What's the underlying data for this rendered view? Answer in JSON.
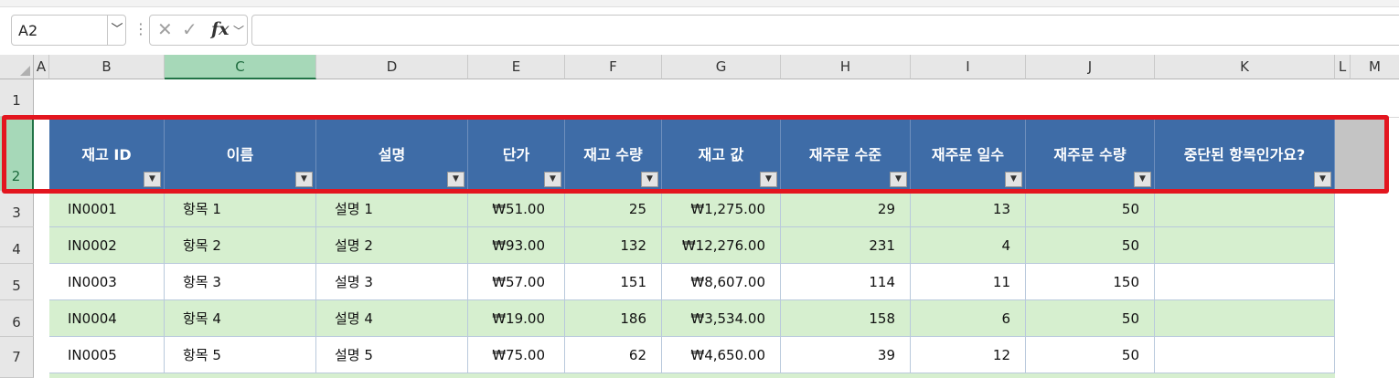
{
  "formula_bar": {
    "name_box": "A2",
    "dots": "⋮",
    "formula": ""
  },
  "columns": [
    "A",
    "B",
    "C",
    "D",
    "E",
    "F",
    "G",
    "H",
    "I",
    "J",
    "K",
    "L",
    "M"
  ],
  "rows": [
    "1",
    "2",
    "3",
    "4",
    "5",
    "6",
    "7"
  ],
  "table": {
    "headers": [
      "재고 ID",
      "이름",
      "설명",
      "단가",
      "재고 수량",
      "재고 값",
      "재주문 수준",
      "재주문 일수",
      "재주문 수량",
      "중단된 항목인가요?"
    ],
    "rows": [
      [
        "IN0001",
        "항목 1",
        "설명 1",
        "₩51.00",
        "25",
        "₩1,275.00",
        "29",
        "13",
        "50",
        ""
      ],
      [
        "IN0002",
        "항목 2",
        "설명 2",
        "₩93.00",
        "132",
        "₩12,276.00",
        "231",
        "4",
        "50",
        ""
      ],
      [
        "IN0003",
        "항목 3",
        "설명 3",
        "₩57.00",
        "151",
        "₩8,607.00",
        "114",
        "11",
        "150",
        ""
      ],
      [
        "IN0004",
        "항목 4",
        "설명 4",
        "₩19.00",
        "186",
        "₩3,534.00",
        "158",
        "6",
        "50",
        ""
      ],
      [
        "IN0005",
        "항목 5",
        "설명 5",
        "₩75.00",
        "62",
        "₩4,650.00",
        "39",
        "12",
        "50",
        ""
      ]
    ]
  },
  "colors": {
    "header_fill": "#3e6ca7",
    "band_fill": "#d6efcf",
    "highlight_frame": "#e3161f",
    "selection": "#217346"
  }
}
